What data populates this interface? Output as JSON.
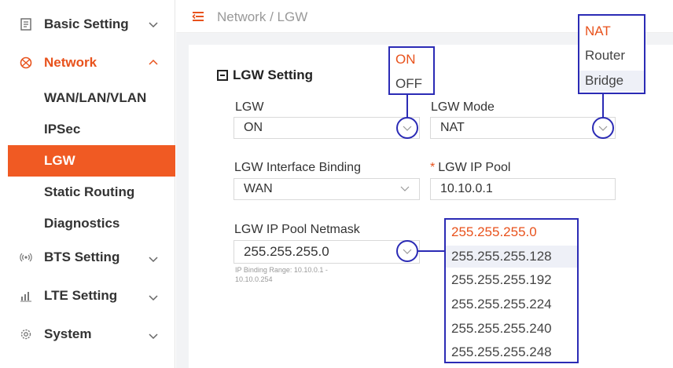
{
  "sidebar": {
    "basic_setting": "Basic Setting",
    "network": "Network",
    "sub": [
      "WAN/LAN/VLAN",
      "IPSec",
      "LGW",
      "Static Routing",
      "Diagnostics"
    ],
    "bts_setting": "BTS Setting",
    "lte_setting": "LTE Setting",
    "system": "System"
  },
  "breadcrumb": "Network / LGW",
  "section_title": "LGW Setting",
  "form": {
    "lgw_label": "LGW",
    "lgw_value": "ON",
    "mode_label": "LGW Mode",
    "mode_value": "NAT",
    "binding_label": "LGW Interface Binding",
    "binding_value": "WAN",
    "pool_required": "*",
    "pool_label": "LGW IP Pool",
    "pool_value": "10.10.0.1",
    "netmask_label": "LGW IP Pool Netmask",
    "netmask_value": "255.255.255.0",
    "hint_line1": "IP Binding Range: 10.10.0.1 -",
    "hint_line2": "10.10.0.254"
  },
  "lgw_options": [
    "ON",
    "OFF"
  ],
  "mode_options": [
    "NAT",
    "Router",
    "Bridge"
  ],
  "netmask_options": [
    "255.255.255.0",
    "255.255.255.128",
    "255.255.255.192",
    "255.255.255.224",
    "255.255.255.240",
    "255.255.255.248"
  ],
  "colors": {
    "accent": "#f05a23",
    "annotation": "#2b2bb5"
  }
}
